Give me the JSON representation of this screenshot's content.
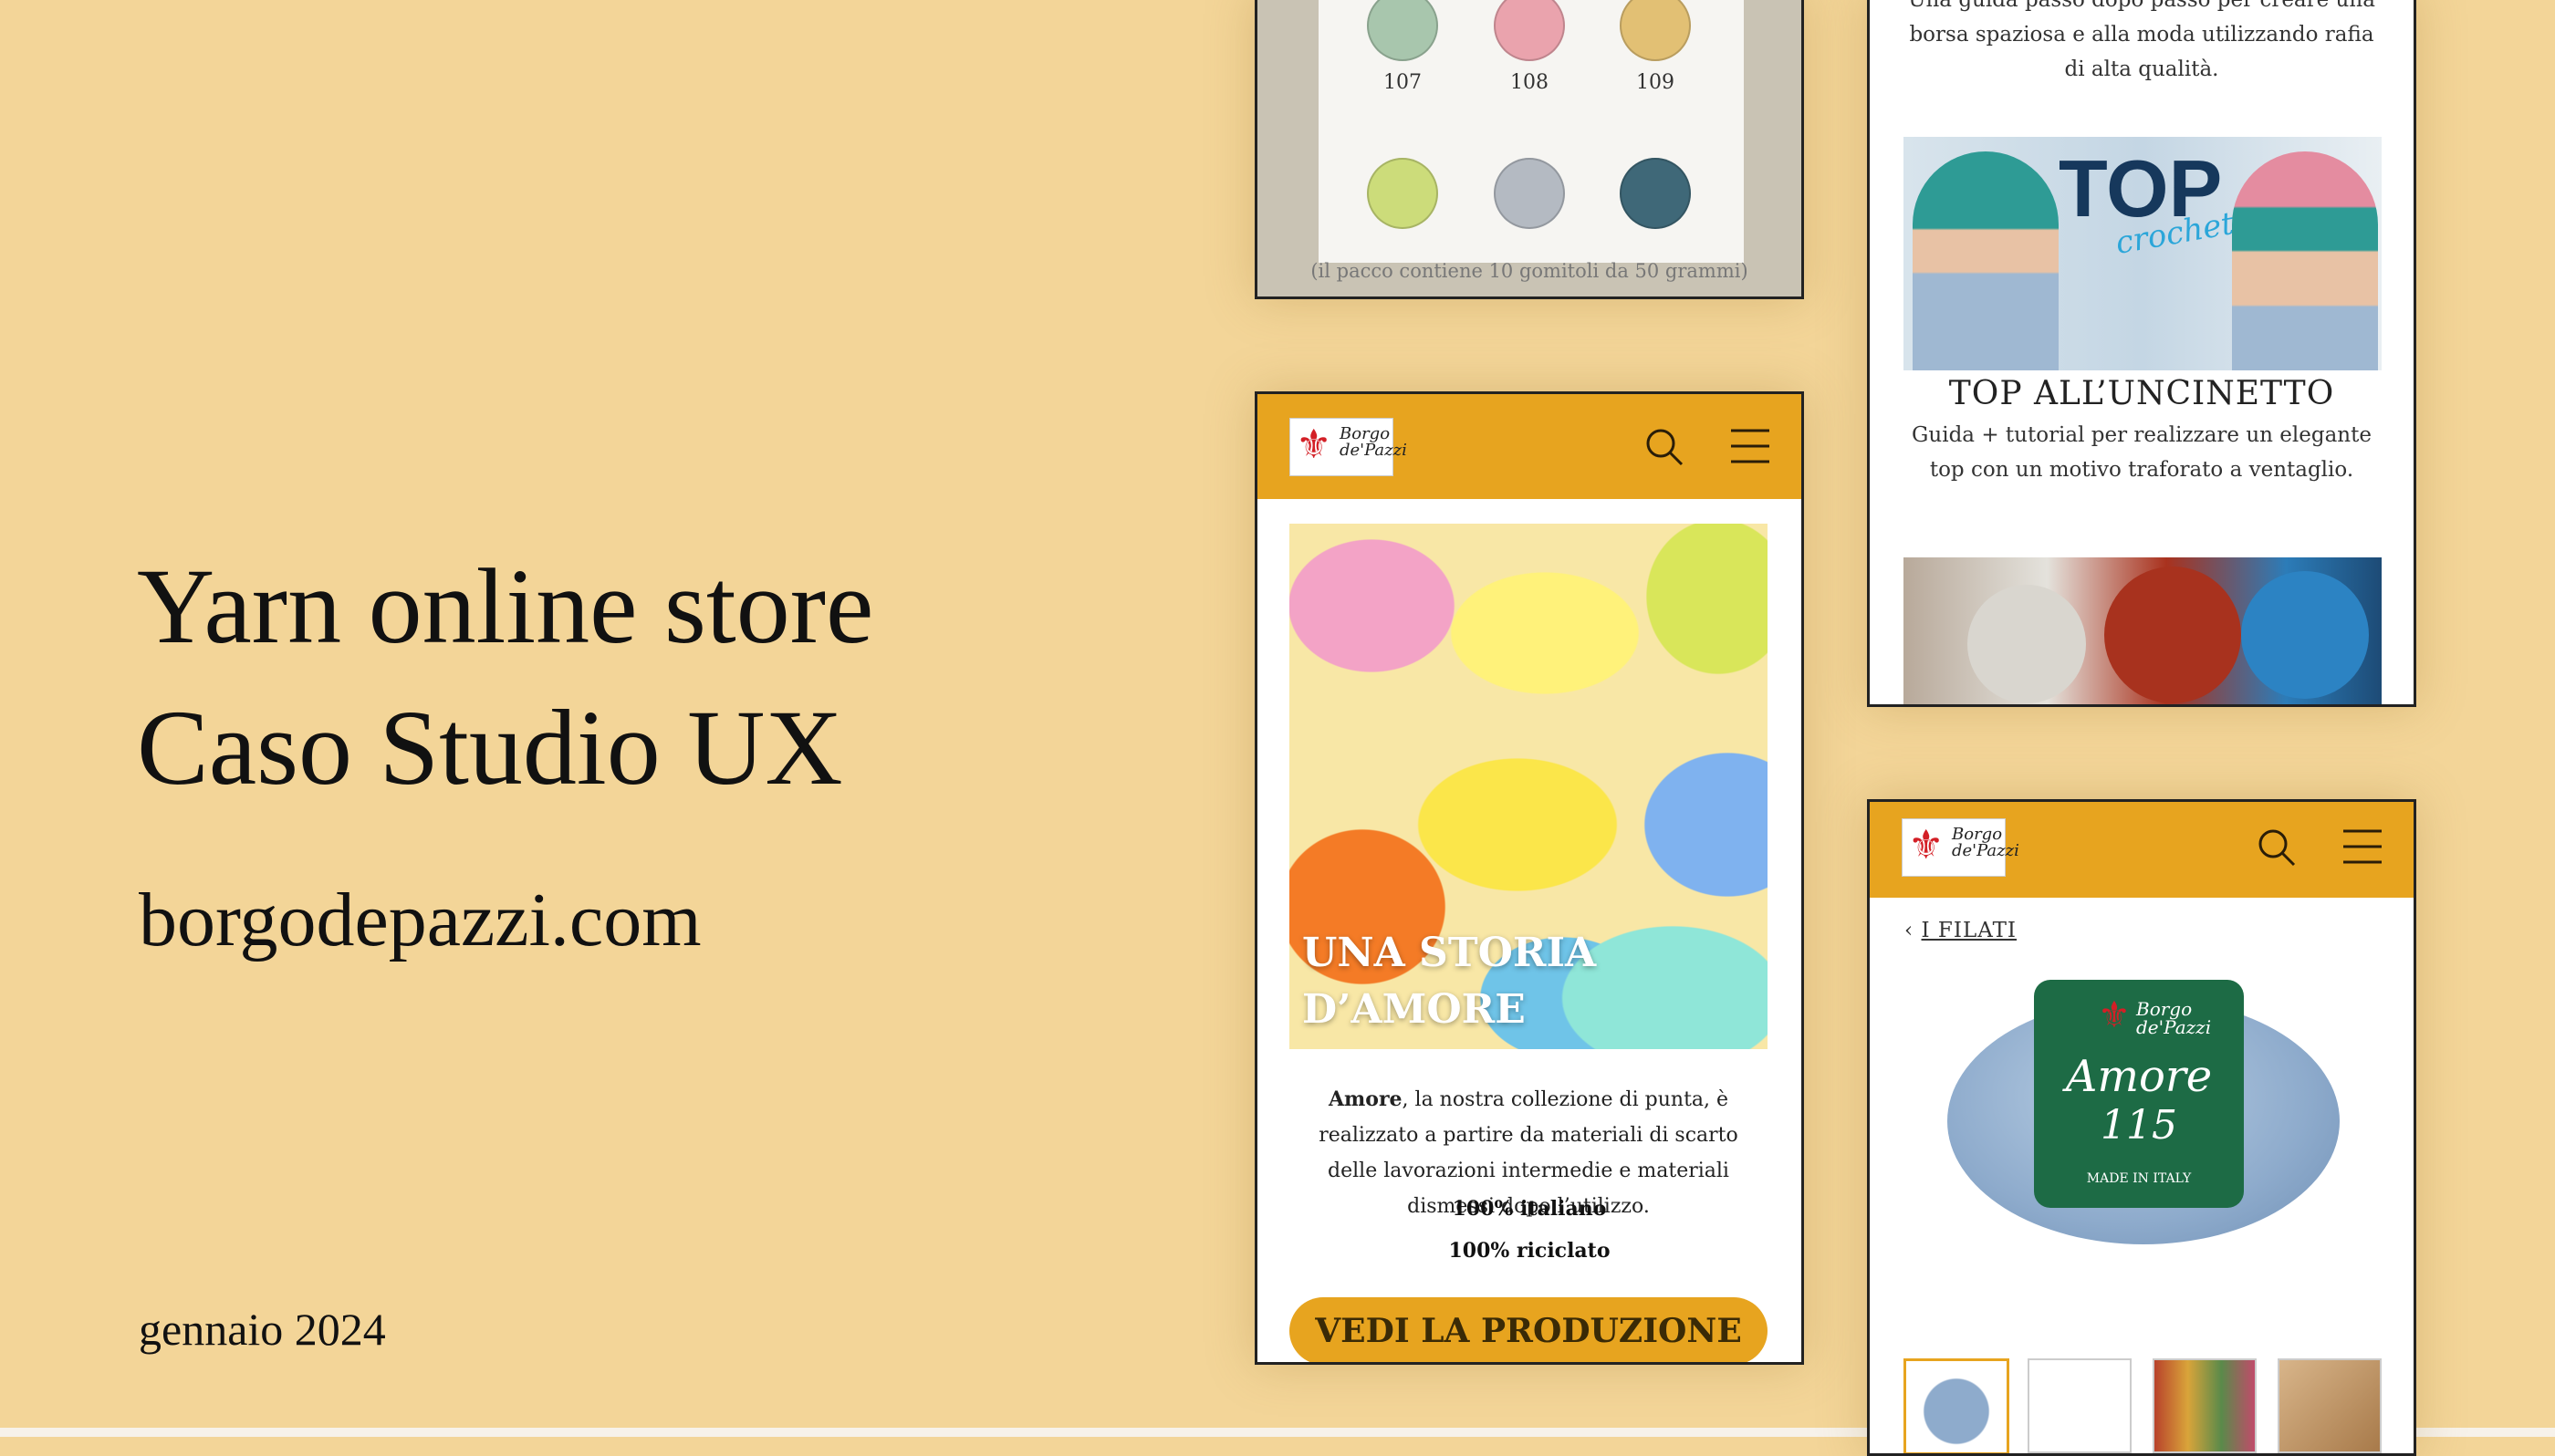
{
  "cover": {
    "title_line1": "Yarn online store",
    "title_line2": "Caso Studio UX",
    "site": "borgodepazzi.com",
    "date": "gennaio 2024"
  },
  "swatch_card": {
    "swatches": [
      {
        "number": "107",
        "color": "#a8c6ad"
      },
      {
        "number": "108",
        "color": "#eaa3ad"
      },
      {
        "number": "109",
        "color": "#e2c074"
      },
      {
        "number": "",
        "color": "#ccdc7a"
      },
      {
        "number": "",
        "color": "#b4bac2"
      },
      {
        "number": "",
        "color": "#3f6878"
      }
    ],
    "pack_note": "(il pacco contiene 10 gomitoli da 50 grammi)"
  },
  "home": {
    "logo_text": "Borgo de'Pazzi",
    "hero_title_line1": "UNA STORIA",
    "hero_title_line2": "D’AMORE",
    "desc_bold": "Amore",
    "desc_rest": ", la nostra collezione di punta, è realizzato a partire da materiali di scarto delle lavorazioni intermedie e materiali dismessi dopo l’utilizzo.",
    "claim1": "100% italiano",
    "claim2": "100% riciclato",
    "cta": "VEDI LA PRODUZIONE"
  },
  "guides": {
    "intro": "Una guida passo dopo passo per creare una borsa spaziosa e alla moda utilizzando rafia di alta qualità.",
    "thumb_word_top": "TOP",
    "thumb_word_crochet": "crochet",
    "guide_title": "TOP ALL’UNCINETTO",
    "guide_desc": "Guida + tutorial per realizzare un elegante top con un motivo traforato a ventaglio."
  },
  "product": {
    "logo_text": "Borgo de'Pazzi",
    "breadcrumb_arrow": "‹",
    "breadcrumb": "I FILATI",
    "label_name": "Amore",
    "label_number": "115",
    "label_note": "MADE IN ITALY",
    "label_brand": "Borgo de'Pazzi"
  },
  "colors": {
    "background": "#f3d598",
    "accent": "#e7a41f",
    "logo_red": "#d31f26"
  },
  "icons": [
    "search-icon",
    "menu-icon",
    "fleur-de-lis-icon",
    "chevron-left-icon"
  ]
}
